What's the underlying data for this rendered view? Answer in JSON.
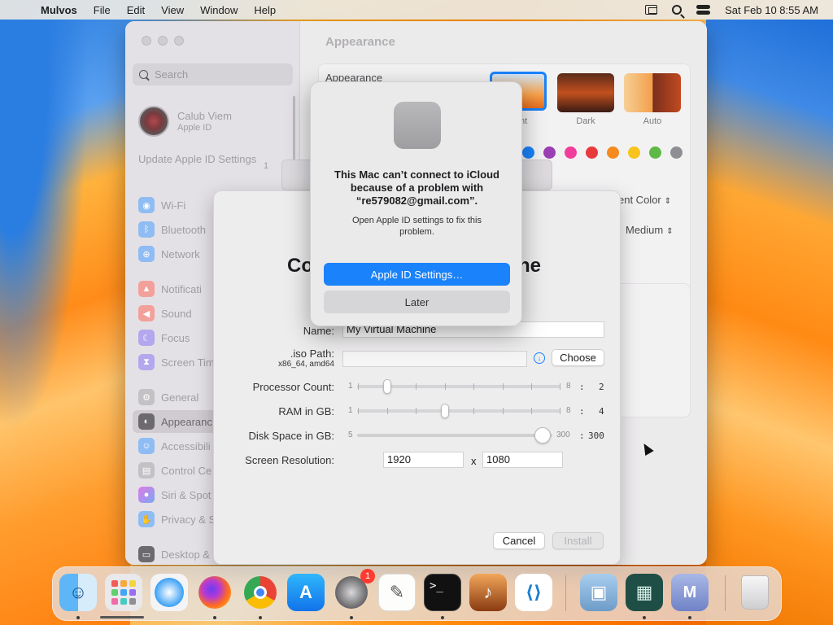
{
  "menubar": {
    "app_name": "Mulvos",
    "items": [
      "File",
      "Edit",
      "View",
      "Window",
      "Help"
    ],
    "datetime": "Sat Feb 10  8:55 AM"
  },
  "sidebar": {
    "search_placeholder": "Search",
    "account_name": "Calub Viem",
    "account_sub": "Apple ID",
    "update_text": "Update Apple ID Settings",
    "update_badge": "1",
    "items": [
      {
        "label": "Wi-Fi",
        "icon": "wifi-icon",
        "color": "#2f8cf5"
      },
      {
        "label": "Bluetooth",
        "icon": "bluetooth-icon",
        "color": "#2f8cf5"
      },
      {
        "label": "Network",
        "icon": "globe-icon",
        "color": "#2f8cf5"
      },
      {
        "label": "Notificati",
        "icon": "bell-icon",
        "color": "#f2473f"
      },
      {
        "label": "Sound",
        "icon": "speaker-icon",
        "color": "#f2473f"
      },
      {
        "label": "Focus",
        "icon": "moon-icon",
        "color": "#6e5ce6"
      },
      {
        "label": "Screen Tim",
        "icon": "hourglass-icon",
        "color": "#6e5ce6"
      },
      {
        "label": "General",
        "icon": "gear-icon",
        "color": "#8e8e93"
      },
      {
        "label": "Appearanc",
        "icon": "appearance-icon",
        "color": "#1d1d1f"
      },
      {
        "label": "Accessibili",
        "icon": "accessibility-icon",
        "color": "#2f8cf5"
      },
      {
        "label": "Control Ce",
        "icon": "control-center-icon",
        "color": "#8e8e93"
      },
      {
        "label": "Siri & Spot",
        "icon": "siri-icon",
        "color": "#c94bd6"
      },
      {
        "label": "Privacy & S",
        "icon": "hand-icon",
        "color": "#2f8cf5"
      },
      {
        "label": "Desktop &",
        "icon": "desktop-icon",
        "color": "#1d1d1f"
      }
    ]
  },
  "content": {
    "title": "Appearance",
    "appearance_label": "Appearance",
    "themes": [
      {
        "label": "ht"
      },
      {
        "label": "Dark"
      },
      {
        "label": "Auto"
      }
    ],
    "accent_colors": [
      "#1a82fb",
      "#9b3fb5",
      "#f13e9a",
      "#e8393b",
      "#f58a1f",
      "#f7c31d",
      "#5fb946",
      "#8e8e93"
    ],
    "accent_label": "ent Color",
    "size_label": "Medium"
  },
  "vm_dialog": {
    "title_left": "Co",
    "title_right": "ne",
    "name_label": "Name:",
    "name_value": "My Virtual Machine",
    "iso_label": ".iso Path:",
    "iso_sub": "x86_64, amd64",
    "choose_label": "Choose",
    "processor_label": "Processor Count:",
    "processor_min": "1",
    "processor_max": "8",
    "processor_value": "2",
    "ram_label": "RAM in GB:",
    "ram_min": "1",
    "ram_max": "8",
    "ram_value": "4",
    "disk_label": "Disk Space in GB:",
    "disk_min": "5",
    "disk_max": "300",
    "disk_value": "300",
    "resolution_label": "Screen Resolution:",
    "res_width": "1920",
    "res_x": "x",
    "res_height": "1080",
    "colon": ":",
    "cancel_label": "Cancel",
    "install_label": "Install"
  },
  "alert": {
    "title": "This Mac can’t connect to iCloud because of a problem with “re579082@gmail.com”.",
    "body": "Open Apple ID settings to fix this problem.",
    "primary_label": "Apple ID Settings…",
    "secondary_label": "Later"
  },
  "dock": {
    "settings_badge": "1",
    "apps": [
      "finder",
      "launchpad",
      "safari",
      "firefox",
      "chrome",
      "app-store",
      "system-settings",
      "textedit",
      "terminal",
      "garageband",
      "vscode",
      "preview",
      "files",
      "mulvos",
      "trash"
    ]
  }
}
